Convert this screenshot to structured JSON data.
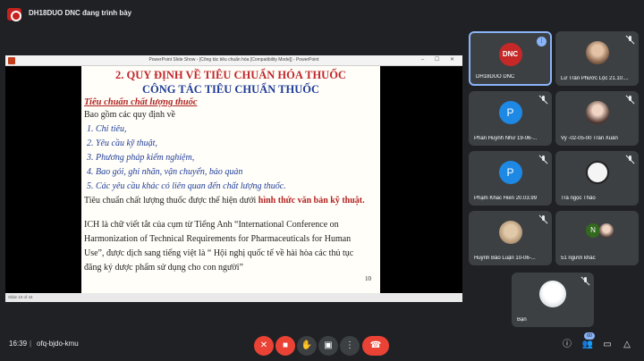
{
  "presenter_banner": "DH18DUO DNC đang trình bày",
  "ppt": {
    "window_caption": "PowerPoint Slide Show - [Công tác tiêu chuẩn hóa [Compatibility Mode]] - PowerPoint",
    "status": "Slide 10 of 44"
  },
  "slide": {
    "title1": "2. QUY ĐỊNH VỀ TIÊU CHUẨN HÓA THUỐC",
    "title2": "CÔNG TÁC TIÊU CHUẨN THUỐC",
    "subhead": "Tiêu chuẩn chất lượng thuốc",
    "intro": "Bao gồm các quy định về",
    "items": [
      "1. Chỉ tiêu,",
      "2. Yêu cầu kỹ thuật,",
      "3. Phương pháp kiểm nghiệm,",
      "4. Bao gói, ghi nhãn, vận chuyển, bảo quản",
      "5. Các yêu cầu khác có liên quan đến chất lượng thuốc."
    ],
    "summary_prefix": "Tiêu chuẩn chất lượng thuốc được thể hiện dưới ",
    "summary_emph": "hình thức văn bản kỹ thuật.",
    "ich_lines": [
      "ICH là chữ viết tắt của cụm từ Tiếng Anh “International Conference on",
      "Harmonization of Technical Requirements for Pharmaceuticals for Human",
      "Use”, được dịch sang tiếng việt là “ Hội nghị quốc tế về hài hòa các thủ tục",
      "đăng ký dược phẩm sử dụng cho con người”"
    ],
    "page_number": "10"
  },
  "participants": [
    {
      "name": "DH18DUO DNC",
      "avatar_text": "DNC",
      "state": "speaking"
    },
    {
      "name": "Lữ Trần Phước Lộc 21.10....",
      "avatar_text": "",
      "state": "muted"
    },
    {
      "name": "Phan Huỳnh Như 19-06-...",
      "avatar_text": "P",
      "state": "muted"
    },
    {
      "name": "Vy -02-05-00 Trần Xuân",
      "avatar_text": "",
      "state": "muted"
    },
    {
      "name": "Phạm Khắc Hiền 20.03.99",
      "avatar_text": "P",
      "state": "muted"
    },
    {
      "name": "Trà ngọc Thảo",
      "avatar_text": "",
      "state": "muted"
    },
    {
      "name": "Huỳnh Bảo Luận 10-06-...",
      "avatar_text": "",
      "state": "muted"
    },
    {
      "name": "51 người khác",
      "avatar_text": "N",
      "state": "none"
    },
    {
      "name": "Bạn",
      "avatar_text": "",
      "state": "muted"
    }
  ],
  "bottom": {
    "time": "16:39",
    "separator": "|",
    "meeting_code": "ofq-bjdo-kmu",
    "people_count": "60"
  },
  "colors": {
    "background": "#202124",
    "tile": "#3c4043",
    "accent": "#8ab4f8",
    "danger": "#ea4335"
  }
}
